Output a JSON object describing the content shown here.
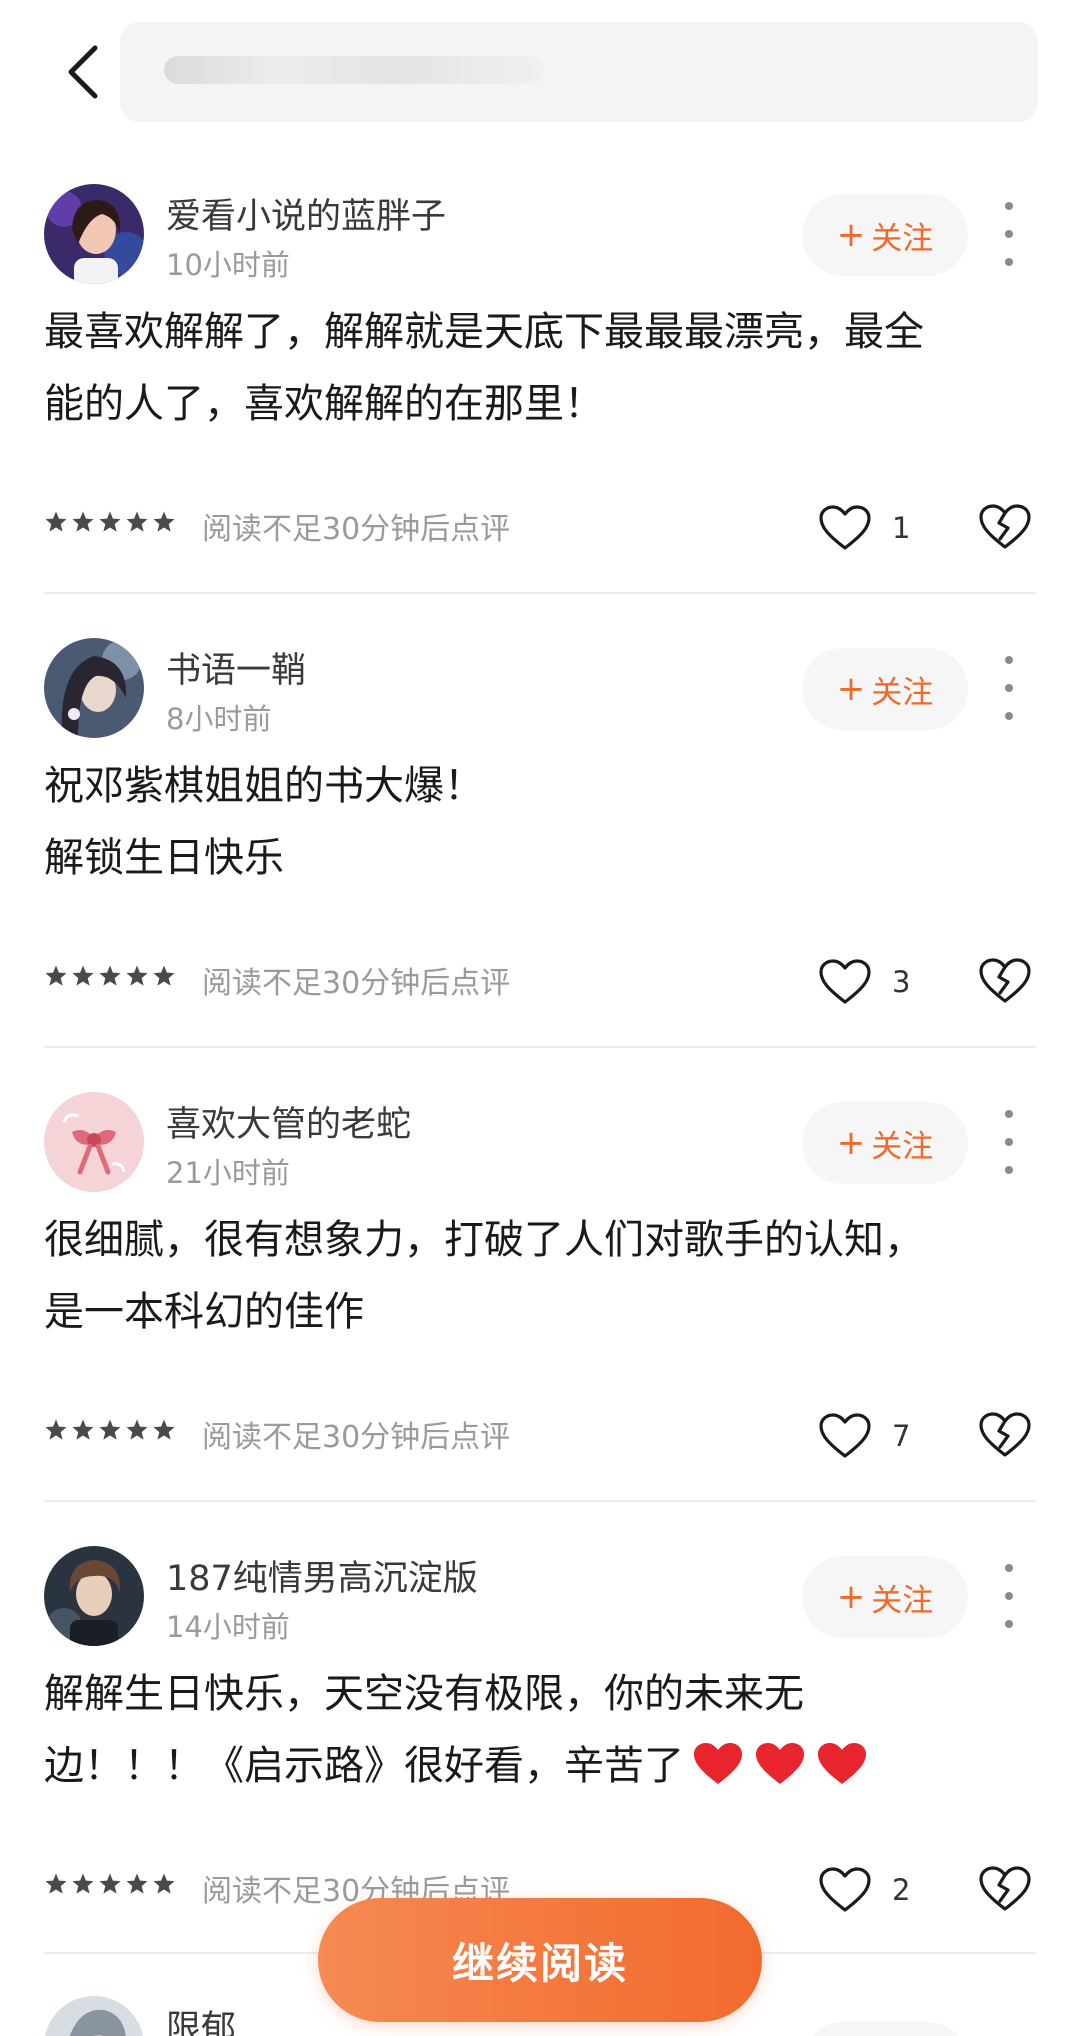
{
  "colors": {
    "accent": "#ef6a2a",
    "button_gradient_start": "#f58a52",
    "button_gradient_end": "#f26a2e",
    "heart_red": "#e8242c"
  },
  "header": {
    "back_icon": "chevron-left-icon",
    "search_icon": "blurred-search-text"
  },
  "comments": [
    {
      "username": "爱看小说的蓝胖子",
      "time": "10小时前",
      "follow_plus": "+",
      "follow_label": "关注",
      "text_lines": [
        "最喜欢解解了，解解就是天底下最最最漂亮，最全",
        "能的人了，喜欢解解的在那里！"
      ],
      "rating_stars": 5,
      "rating_note": "阅读不足30分钟后点评",
      "likes": "1"
    },
    {
      "username": "书语一鞘",
      "time": "8小时前",
      "follow_plus": "+",
      "follow_label": "关注",
      "text_lines": [
        "祝邓紫棋姐姐的书大爆！",
        "解锁生日快乐"
      ],
      "rating_stars": 5,
      "rating_note": "阅读不足30分钟后点评",
      "likes": "3"
    },
    {
      "username": "喜欢大管的老蛇",
      "time": "21小时前",
      "follow_plus": "+",
      "follow_label": "关注",
      "text_lines": [
        "很细腻，很有想象力，打破了人们对歌手的认知，",
        "是一本科幻的佳作"
      ],
      "rating_stars": 5,
      "rating_note": "阅读不足30分钟后点评",
      "likes": "7"
    },
    {
      "username": "187纯情男高沉淀版",
      "time": "14小时前",
      "follow_plus": "+",
      "follow_label": "关注",
      "text_lines": [
        "解解生日快乐，天空没有极限，你的未来无",
        "边！！！《启示路》很好看，辛苦了"
      ],
      "emoji_hearts": 3,
      "rating_stars": 5,
      "rating_note": "阅读不足30分钟后点评",
      "likes": "2"
    },
    {
      "username": "限郁"
    }
  ],
  "continue_button": {
    "label": "继续阅读"
  }
}
